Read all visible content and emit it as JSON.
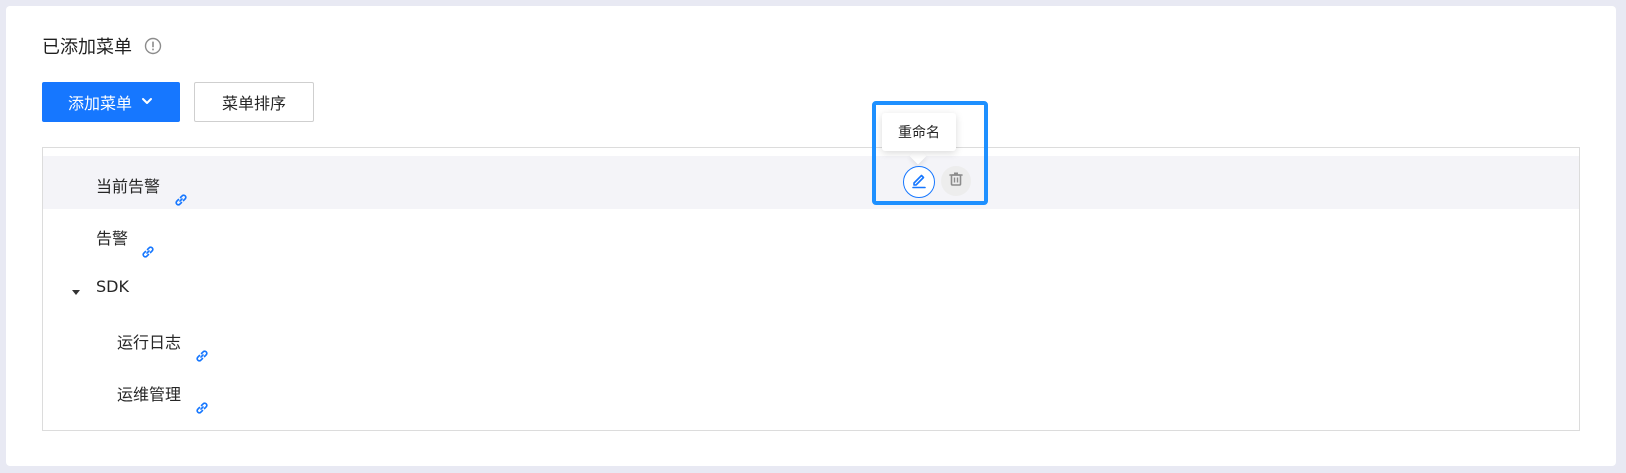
{
  "section": {
    "title": "已添加菜单",
    "info_icon": "info-circle-icon"
  },
  "toolbar": {
    "add_menu_label": "添加菜单",
    "sort_menu_label": "菜单排序"
  },
  "tree": {
    "items": [
      {
        "label": "当前告警",
        "icon": "link-icon",
        "level": 1,
        "hovered": true
      },
      {
        "label": "告警",
        "icon": "link-icon",
        "level": 1
      },
      {
        "label": "SDK",
        "icon": "caret-down-icon",
        "level": 1,
        "expanded": true
      },
      {
        "label": "运行日志",
        "icon": "link-icon",
        "level": 2
      },
      {
        "label": "运维管理",
        "icon": "link-icon",
        "level": 2
      }
    ]
  },
  "row_actions": {
    "tooltip": "重命名",
    "edit_icon": "edit-icon",
    "delete_icon": "trash-icon"
  },
  "colors": {
    "primary": "#1677ff",
    "highlight": "#1e90ff",
    "hover_row": "#f4f4f8"
  }
}
